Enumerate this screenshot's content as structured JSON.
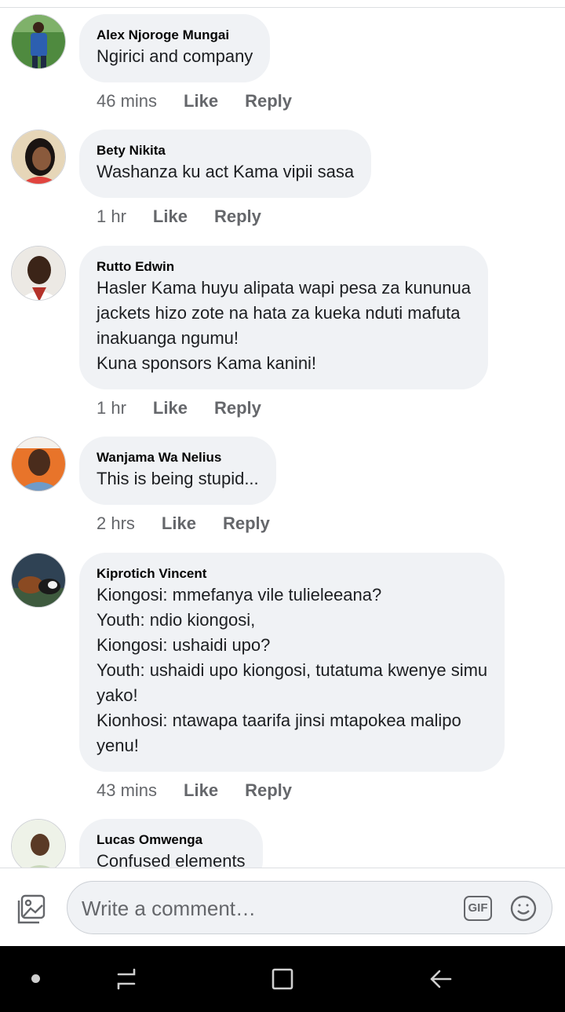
{
  "comments": [
    {
      "author": "Alex Njoroge Mungai",
      "text": "Ngirici and company",
      "time": "46 mins",
      "like": "Like",
      "reply": "Reply",
      "avatar_icon": "avatar-person-blue-shirt",
      "avatar_color": "#3a7a3a"
    },
    {
      "author": "Bety Nikita",
      "text": "Washanza ku act Kama vipii  sasa",
      "time": "1 hr",
      "like": "Like",
      "reply": "Reply",
      "avatar_icon": "avatar-woman",
      "avatar_color": "#d9c5a0"
    },
    {
      "author": "Rutto Edwin",
      "text": "Hasler Kama huyu alipata wapi pesa za kununua\njackets hizo zote na hata za kueka nduti mafuta\ninakuanga ngumu!\nKuna sponsors Kama kanini!",
      "time": "1 hr",
      "like": "Like",
      "reply": "Reply",
      "avatar_icon": "avatar-man",
      "avatar_color": "#e8e4df"
    },
    {
      "author": "Wanjama Wa Nelius",
      "text": "This is being stupid...",
      "time": "2 hrs",
      "like": "Like",
      "reply": "Reply",
      "avatar_icon": "avatar-man-orange-bg",
      "avatar_color": "#e8742a"
    },
    {
      "author": "Kiprotich Vincent",
      "text": "Kiongosi: mmefanya vile tulieleeana?\nYouth: ndio kiongosi,\nKiongosi: ushaidi upo?\nYouth: ushaidi upo kiongosi, tutatuma kwenye simu\nyako!\nKionhosi: ntawapa taarifa jinsi mtapokea malipo\nyenu!",
      "time": "43 mins",
      "like": "Like",
      "reply": "Reply",
      "avatar_icon": "avatar-cows",
      "avatar_color": "#2b3a4a"
    },
    {
      "author": "Lucas Omwenga",
      "text": "Confused elements",
      "avatar_icon": "avatar-blessed",
      "avatar_color": "#dfe7d5"
    }
  ],
  "composer": {
    "placeholder": "Write a comment…",
    "gif_label": "GIF",
    "photo_icon": "photo-icon",
    "emoji_icon": "emoji-icon"
  },
  "navbar": {
    "icons": [
      "dot-icon",
      "recent-apps-icon",
      "home-icon",
      "back-icon"
    ]
  }
}
